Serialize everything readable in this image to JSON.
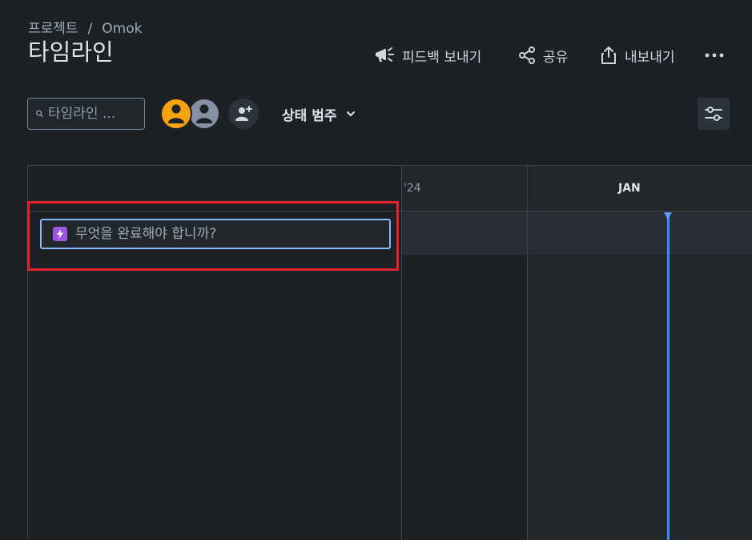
{
  "breadcrumb": {
    "project": "프로젝트",
    "separator": "/",
    "current": "Omok"
  },
  "page": {
    "title": "타임라인"
  },
  "actions": {
    "feedback": {
      "label": "피드백 보내기",
      "icon": "megaphone-icon"
    },
    "share": {
      "label": "공유",
      "icon": "share-icon"
    },
    "export": {
      "label": "내보내기",
      "icon": "export-icon"
    },
    "more": {
      "icon": "more-icon"
    }
  },
  "toolbar": {
    "search_placeholder": "타임라인 ...",
    "avatars": [
      {
        "name": "user-avatar-1",
        "color": "#f5a30e"
      },
      {
        "name": "user-avatar-2",
        "color": "#8590a2"
      }
    ],
    "status_filter_label": "상태 범주"
  },
  "timeline": {
    "year_label": "'24",
    "month_label": "JAN",
    "create_placeholder": "무엇을 완료해야 합니까?",
    "today_color": "#388bff"
  },
  "colors": {
    "background": "#1d2025",
    "epic": "#9f55e0",
    "focus_border": "#85b8ff",
    "highlight": "#e3242b"
  }
}
